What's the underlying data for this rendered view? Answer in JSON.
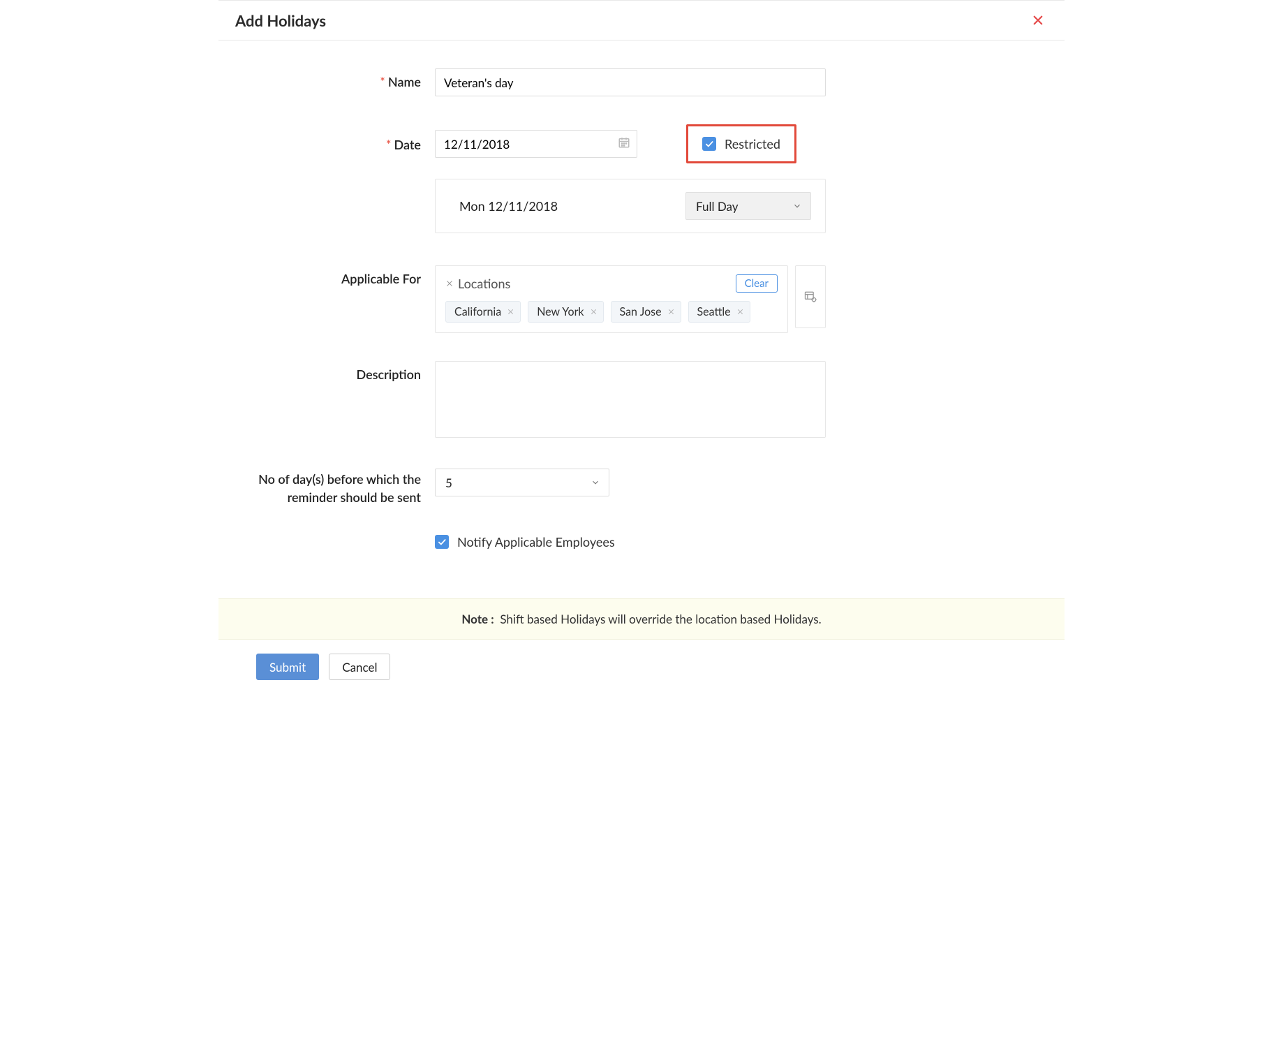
{
  "header": {
    "title": "Add Holidays"
  },
  "labels": {
    "name": "Name",
    "date": "Date",
    "applicable_for": "Applicable For",
    "description": "Description",
    "reminder_days": "No of day(s) before which the reminder should be sent"
  },
  "form": {
    "name_value": "Veteran's day",
    "date_value": "12/11/2018",
    "restricted": {
      "checked": true,
      "label": "Restricted"
    },
    "day_display": "Mon 12/11/2018",
    "day_type": "Full Day",
    "locations_label": "Locations",
    "clear_label": "Clear",
    "location_chips": [
      "California",
      "New York",
      "San Jose",
      "Seattle"
    ],
    "description_value": "",
    "reminder_days_value": "5",
    "notify": {
      "checked": true,
      "label": "Notify Applicable Employees"
    }
  },
  "note": {
    "prefix": "Note :",
    "text": "Shift based Holidays will override the location based Holidays."
  },
  "footer": {
    "submit": "Submit",
    "cancel": "Cancel"
  }
}
